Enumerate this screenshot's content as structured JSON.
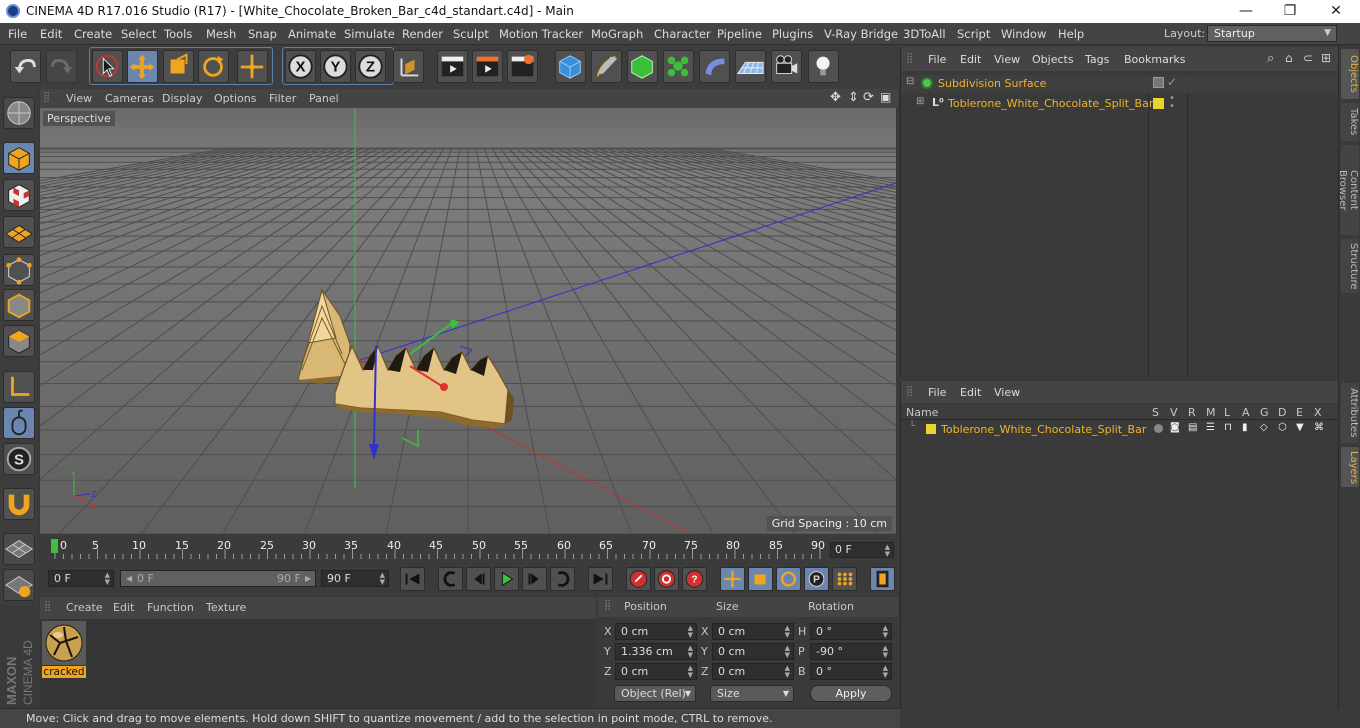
{
  "window": {
    "title": "CINEMA 4D R17.016 Studio (R17) - [White_Chocolate_Broken_Bar_c4d_standart.c4d] - Main",
    "minimize_glyph": "—",
    "maximize_glyph": "❐",
    "close_glyph": "✕"
  },
  "menubar": {
    "items": [
      "File",
      "Edit",
      "Create",
      "Select",
      "Tools",
      "Mesh",
      "Snap",
      "Animate",
      "Simulate",
      "Render",
      "Sculpt",
      "Motion Tracker",
      "MoGraph",
      "Character",
      "Pipeline",
      "Plugins",
      "V-Ray Bridge",
      "3DToAll",
      "Script",
      "Window",
      "Help"
    ],
    "layout_label": "Layout:",
    "layout_value": "Startup"
  },
  "toolbar": {
    "axis_x": "X",
    "axis_y": "Y",
    "axis_z": "Z"
  },
  "viewport": {
    "menu": [
      "View",
      "Cameras",
      "Display",
      "Options",
      "Filter",
      "Panel"
    ],
    "camera_label": "Perspective",
    "grid_spacing": "Grid Spacing : 10 cm",
    "axis_labels": {
      "x": "X",
      "y": "Y",
      "z": "Z"
    }
  },
  "timeline": {
    "ticks": [
      "0",
      "5",
      "10",
      "15",
      "20",
      "25",
      "30",
      "35",
      "40",
      "45",
      "50",
      "55",
      "60",
      "65",
      "70",
      "75",
      "80",
      "85",
      "90"
    ],
    "current_frame": "0 F"
  },
  "transport": {
    "start_field": "0 F",
    "range_start": "0 F",
    "range_end": "90 F",
    "end_field": "90 F"
  },
  "material_manager": {
    "menu": [
      "Create",
      "Edit",
      "Function",
      "Texture"
    ],
    "materials": [
      {
        "name": "cracked"
      }
    ]
  },
  "coordinates": {
    "headers": {
      "position": "Position",
      "size": "Size",
      "rotation": "Rotation"
    },
    "rows": [
      {
        "axis": "X",
        "pos": "0 cm",
        "size_axis": "X",
        "size": "0 cm",
        "rot_axis": "H",
        "rot": "0 °"
      },
      {
        "axis": "Y",
        "pos": "1.336 cm",
        "size_axis": "Y",
        "size": "0 cm",
        "rot_axis": "P",
        "rot": "-90 °"
      },
      {
        "axis": "Z",
        "pos": "0 cm",
        "size_axis": "Z",
        "size": "0 cm",
        "rot_axis": "B",
        "rot": "0 °"
      }
    ],
    "mode_select": "Object (Rel)",
    "size_select": "Size",
    "apply_label": "Apply"
  },
  "status": {
    "message": "Move: Click and drag to move elements. Hold down SHIFT to quantize movement / add to the selection in point mode, CTRL to remove."
  },
  "object_manager": {
    "menu": [
      "File",
      "Edit",
      "View",
      "Objects",
      "Tags",
      "Bookmarks"
    ],
    "objects": [
      {
        "name": "Subdivision Surface",
        "level": 0
      },
      {
        "name": "Toblerone_White_Chocolate_Split_Bar",
        "level": 1
      }
    ]
  },
  "layer_manager": {
    "menu": [
      "File",
      "Edit",
      "View"
    ],
    "columns": [
      "Name",
      "S",
      "V",
      "R",
      "M",
      "L",
      "A",
      "G",
      "D",
      "E",
      "X"
    ],
    "layers": [
      {
        "name": "Toblerone_White_Chocolate_Split_Bar"
      }
    ]
  },
  "side_tabs": [
    "Objects",
    "Takes",
    "Content Browser",
    "Structure",
    "Attributes",
    "Layers"
  ],
  "colors": {
    "accent_orange": "#f0b429",
    "layer_yellow": "#e7d52a",
    "selected_blue": "#6b87b0",
    "subdivision_green": "#58c04c"
  }
}
